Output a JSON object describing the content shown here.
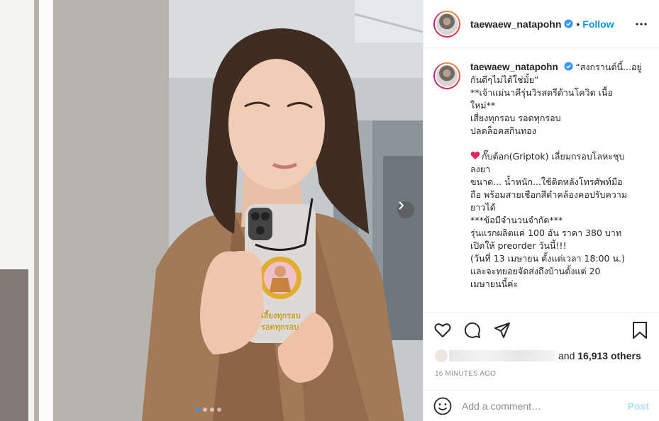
{
  "post": {
    "username": "taewaew_natapohn",
    "follow_label": "Follow",
    "separator": "•",
    "photo": {
      "amulet_text_line1": "เลี้ยงทุกรอบ",
      "amulet_text_line2": "รอดทุกรอบ",
      "carousel_count": 4,
      "carousel_active": 1
    },
    "caption": {
      "lines": [
        "“สงกรานต์นี้...อยู่",
        "กันดีๆไม่ได้ใช่มั้ย”",
        "**เจ้าแม่นาคีรุ่นวิรสตรีต้านโควิด เนื้อ",
        "ใหม่**",
        "เสี่ยงทุกรอบ รอดทุกรอบ",
        "ปลดล็อคสกินทอง",
        "",
        "กั๊บต้อก(Griptok) เลี่ยมกรอบโลหะชุบ",
        "ลงยา",
        "ขนาด... น้ำหนัก...ใช้ติดหลังโทรศัพท์มือ",
        "ถือ พร้อมสายเชือกสีดำคล้องคอปรับความ",
        "ยาวได้",
        "***ข้อมีจำนวนจำกัด***",
        "รุ่นแรกผลิตแค่ 100 อัน ราคา 380 บาท",
        "เปิดให้ preorder วันนี้!!!",
        "(วันที่ 13 เมษายน ตั้งแต่เวลา 18:00 น.)",
        "และจะทยอยจัดส่งถึงบ้านตั้งแต่ 20",
        "เมษายนนี้ค่ะ"
      ]
    },
    "likes": {
      "and_label": "and",
      "count": "16,913 others"
    },
    "timestamp": "16 MINUTES AGO",
    "comment_input": {
      "placeholder": "Add a comment…",
      "post_label": "Post"
    },
    "colors": {
      "follow": "#0095f6",
      "verified": "#3897f0",
      "post_disabled": "#b2dffc",
      "heart_emoji": "#e0245e"
    },
    "icons": {
      "verified": "verified-badge-icon",
      "more": "more-options-icon",
      "like": "heart-icon",
      "comment": "comment-icon",
      "share": "share-icon",
      "save": "bookmark-icon",
      "emoji": "emoji-icon",
      "next": "chevron-right-icon"
    }
  }
}
